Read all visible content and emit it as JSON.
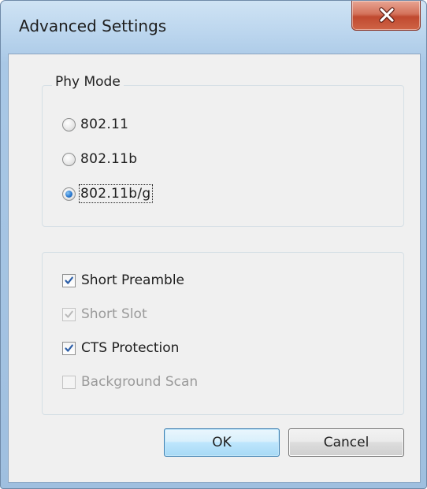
{
  "window": {
    "title": "Advanced Settings"
  },
  "phy_mode": {
    "legend": "Phy Mode",
    "options": [
      {
        "label": "802.11",
        "selected": false
      },
      {
        "label": "802.11b",
        "selected": false
      },
      {
        "label": "802.11b/g",
        "selected": true
      }
    ]
  },
  "options": {
    "items": [
      {
        "label": "Short Preamble",
        "checked": true,
        "enabled": true
      },
      {
        "label": "Short Slot",
        "checked": true,
        "enabled": false
      },
      {
        "label": "CTS Protection",
        "checked": true,
        "enabled": true
      },
      {
        "label": "Background Scan",
        "checked": false,
        "enabled": false
      }
    ]
  },
  "buttons": {
    "ok_label": "OK",
    "cancel_label": "Cancel"
  },
  "colors": {
    "title_bar": "#bcd6ee",
    "close_button": "#c94f36",
    "ok_border": "#3c7fb1",
    "radio_dot": "#2b7ad0",
    "check_mark": "#2d5fa8",
    "disabled_text": "#9a9a9a"
  },
  "icons": {
    "close": "close-icon",
    "check": "checkmark-icon"
  }
}
